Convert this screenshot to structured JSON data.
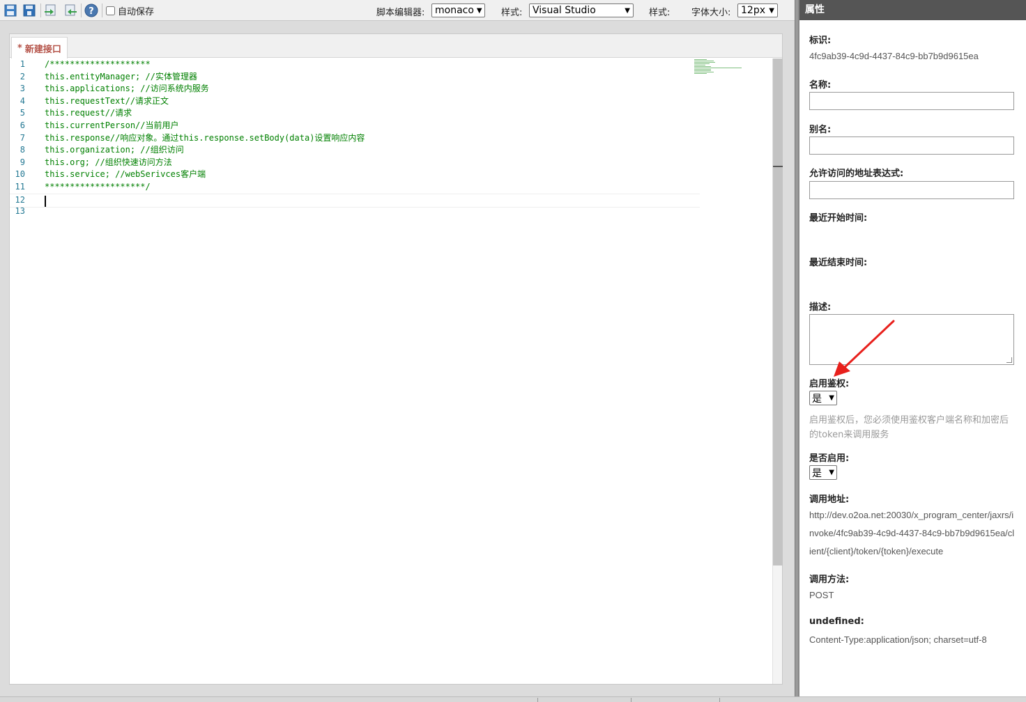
{
  "toolbar": {
    "autosave_label": "自动保存",
    "editor_label": "脚本编辑器:",
    "editor_value": "monaco",
    "style_label": "样式:",
    "style_value": "Visual Studio",
    "style_label_2": "样式:",
    "fontsize_label": "字体大小:",
    "fontsize_value": "12px"
  },
  "tab": {
    "label": "新建接口",
    "modified_marker": "*"
  },
  "code": [
    {
      "n": "1",
      "t": "/********************"
    },
    {
      "n": "2",
      "t": "this.entityManager; //实体管理器"
    },
    {
      "n": "3",
      "t": "this.applications; //访问系统内服务"
    },
    {
      "n": "4",
      "t": "this.requestText//请求正文"
    },
    {
      "n": "5",
      "t": "this.request//请求"
    },
    {
      "n": "6",
      "t": "this.currentPerson//当前用户"
    },
    {
      "n": "7",
      "t": "this.response//响应对象。通过this.response.setBody(data)设置响应内容"
    },
    {
      "n": "8",
      "t": "this.organization; //组织访问"
    },
    {
      "n": "9",
      "t": "this.org; //组织快速访问方法"
    },
    {
      "n": "10",
      "t": "this.service; //webSerivces客户端"
    },
    {
      "n": "11",
      "t": "********************/"
    },
    {
      "n": "12",
      "t": ""
    },
    {
      "n": "13",
      "t": ""
    }
  ],
  "props": {
    "title": "属性",
    "id_label": "标识:",
    "id_value": "4fc9ab39-4c9d-4437-84c9-bb7b9d9615ea",
    "name_label": "名称:",
    "alias_label": "别名:",
    "allowed_label": "允许访问的地址表达式:",
    "start_label": "最近开始时间:",
    "end_label": "最近结束时间:",
    "desc_label": "描述:",
    "auth_label": "启用鉴权:",
    "auth_value": "是",
    "auth_hint": "启用鉴权后，您必须使用鉴权客户端名称和加密后的token来调用服务",
    "enabled_label": "是否启用:",
    "enabled_value": "是",
    "url_label": "调用地址:",
    "url_value": "http://dev.o2oa.net:20030/x_program_center/jaxrs/invoke/4fc9ab39-4c9d-4437-84c9-bb7b9d9615ea/client/{client}/token/{token}/execute",
    "method_label": "调用方法:",
    "method_value": "POST",
    "undef_label": "undefined:",
    "undef_value": "Content-Type:application/json; charset=utf-8"
  },
  "icons": [
    "save-icon",
    "save-all-icon",
    "import-icon",
    "export-icon",
    "help-icon"
  ],
  "colors": {
    "code_comment": "#008000",
    "line_number": "#237893",
    "tab_text": "#b5544a",
    "header_bg": "#555555",
    "arrow": "#e8201c"
  }
}
